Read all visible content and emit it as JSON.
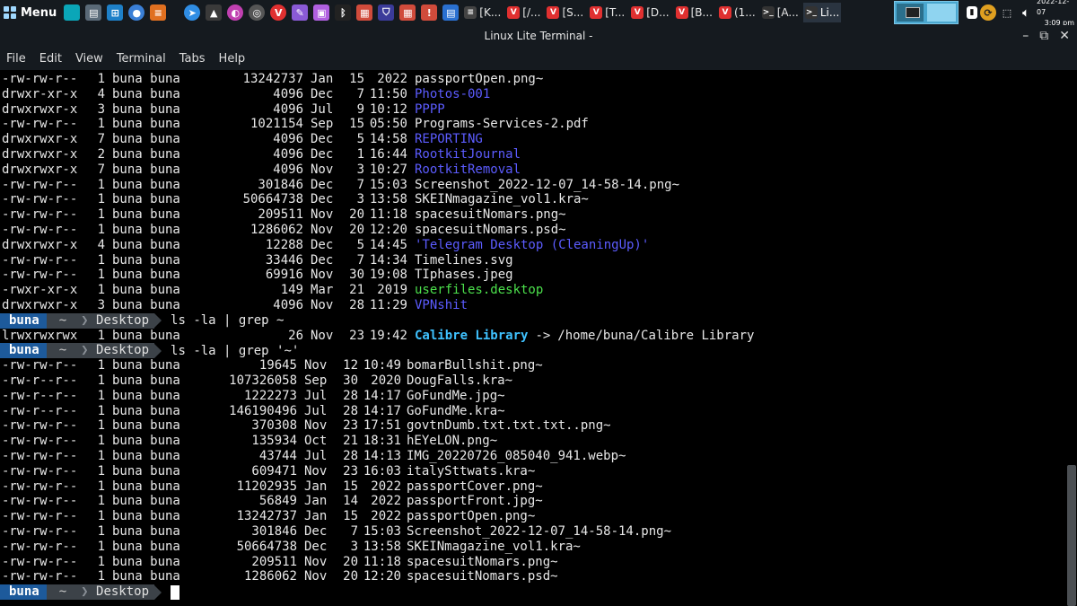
{
  "taskbar": {
    "menu_label": "Menu",
    "tasks": [
      {
        "label": "[K...",
        "icon": "app-icon"
      },
      {
        "label": "[/...",
        "icon": "vivaldi-icon"
      },
      {
        "label": "[S...",
        "icon": "vivaldi-icon"
      },
      {
        "label": "[T...",
        "icon": "vivaldi-icon"
      },
      {
        "label": "[D...",
        "icon": "vivaldi-icon"
      },
      {
        "label": "[B...",
        "icon": "vivaldi-icon"
      },
      {
        "label": "(1...",
        "icon": "vivaldi-icon"
      },
      {
        "label": "[A...",
        "icon": "terminal-icon"
      },
      {
        "label": "Li...",
        "icon": "terminal-icon"
      }
    ],
    "clock": {
      "date": "2022-12-07",
      "time": "3:09 pm"
    }
  },
  "window": {
    "title": "Linux Lite Terminal -"
  },
  "menubar": {
    "items": [
      "File",
      "Edit",
      "View",
      "Terminal",
      "Tabs",
      "Help"
    ]
  },
  "colors": {
    "dir": "#5c5cff",
    "exe": "#4ce04c",
    "link": "#3fc2ff",
    "prompt_user_bg": "#1d5a9b",
    "prompt_path_bg": "#3c4248"
  },
  "listing1": [
    {
      "perm": "-rw-rw-r--",
      "links": "1",
      "owner": "buna buna",
      "size": "13242737",
      "month": "Jan",
      "day": "15",
      "time": "2022",
      "name": "passportOpen.png~",
      "type": "file"
    },
    {
      "perm": "drwxr-xr-x",
      "links": "4",
      "owner": "buna buna",
      "size": "4096",
      "month": "Dec",
      "day": "7",
      "time": "11:50",
      "name": "Photos-001",
      "type": "dir"
    },
    {
      "perm": "drwxrwxr-x",
      "links": "3",
      "owner": "buna buna",
      "size": "4096",
      "month": "Jul",
      "day": "9",
      "time": "10:12",
      "name": "PPPP",
      "type": "dir"
    },
    {
      "perm": "-rw-rw-r--",
      "links": "1",
      "owner": "buna buna",
      "size": "1021154",
      "month": "Sep",
      "day": "15",
      "time": "05:50",
      "name": "Programs-Services-2.pdf",
      "type": "file"
    },
    {
      "perm": "drwxrwxr-x",
      "links": "7",
      "owner": "buna buna",
      "size": "4096",
      "month": "Dec",
      "day": "5",
      "time": "14:58",
      "name": "REPORTING",
      "type": "dir"
    },
    {
      "perm": "drwxrwxr-x",
      "links": "2",
      "owner": "buna buna",
      "size": "4096",
      "month": "Dec",
      "day": "1",
      "time": "16:44",
      "name": "RootkitJournal",
      "type": "dir"
    },
    {
      "perm": "drwxrwxr-x",
      "links": "7",
      "owner": "buna buna",
      "size": "4096",
      "month": "Nov",
      "day": "3",
      "time": "10:27",
      "name": "RootkitRemoval",
      "type": "dir"
    },
    {
      "perm": "-rw-rw-r--",
      "links": "1",
      "owner": "buna buna",
      "size": "301846",
      "month": "Dec",
      "day": "7",
      "time": "15:03",
      "name": "Screenshot_2022-12-07_14-58-14.png~",
      "type": "file"
    },
    {
      "perm": "-rw-rw-r--",
      "links": "1",
      "owner": "buna buna",
      "size": "50664738",
      "month": "Dec",
      "day": "3",
      "time": "13:58",
      "name": "SKEINmagazine_vol1.kra~",
      "type": "file"
    },
    {
      "perm": "-rw-rw-r--",
      "links": "1",
      "owner": "buna buna",
      "size": "209511",
      "month": "Nov",
      "day": "20",
      "time": "11:18",
      "name": "spacesuitNomars.png~",
      "type": "file"
    },
    {
      "perm": "-rw-rw-r--",
      "links": "1",
      "owner": "buna buna",
      "size": "1286062",
      "month": "Nov",
      "day": "20",
      "time": "12:20",
      "name": "spacesuitNomars.psd~",
      "type": "file"
    },
    {
      "perm": "drwxrwxr-x",
      "links": "4",
      "owner": "buna buna",
      "size": "12288",
      "month": "Dec",
      "day": "5",
      "time": "14:45",
      "name": "'Telegram Desktop (CleaningUp)'",
      "type": "dir"
    },
    {
      "perm": "-rw-rw-r--",
      "links": "1",
      "owner": "buna buna",
      "size": "33446",
      "month": "Dec",
      "day": "7",
      "time": "14:34",
      "name": "Timelines.svg",
      "type": "file"
    },
    {
      "perm": "-rw-rw-r--",
      "links": "1",
      "owner": "buna buna",
      "size": "69916",
      "month": "Nov",
      "day": "30",
      "time": "19:08",
      "name": "TIphases.jpeg",
      "type": "file"
    },
    {
      "perm": "-rwxr-xr-x",
      "links": "1",
      "owner": "buna buna",
      "size": "149",
      "month": "Mar",
      "day": "21",
      "time": "2019",
      "name": "userfiles.desktop",
      "type": "exe"
    },
    {
      "perm": "drwxrwxr-x",
      "links": "3",
      "owner": "buna buna",
      "size": "4096",
      "month": "Nov",
      "day": "28",
      "time": "11:29",
      "name": "VPNshit",
      "type": "dir"
    }
  ],
  "prompt1": {
    "user": "buna",
    "home": "~",
    "dir": "Desktop",
    "command": "ls -la | grep ~"
  },
  "link_line": {
    "perm": "lrwxrwxrwx",
    "links": "1",
    "owner": "buna buna",
    "size": "26",
    "month": "Nov",
    "day": "23",
    "time": "19:42",
    "name": "Calibre Library",
    "arrow": "->",
    "target": "/home/buna/Calibre Library"
  },
  "prompt2": {
    "user": "buna",
    "home": "~",
    "dir": "Desktop",
    "command": "ls -la | grep '~'"
  },
  "listing2": [
    {
      "perm": "-rw-rw-r--",
      "links": "1",
      "owner": "buna buna",
      "size": "19645",
      "month": "Nov",
      "day": "12",
      "time": "10:49",
      "name": "bomarBullshit.png~"
    },
    {
      "perm": "-rw-r--r--",
      "links": "1",
      "owner": "buna buna",
      "size": "107326058",
      "month": "Sep",
      "day": "30",
      "time": "2020",
      "name": "DougFalls.kra~"
    },
    {
      "perm": "-rw-r--r--",
      "links": "1",
      "owner": "buna buna",
      "size": "1222273",
      "month": "Jul",
      "day": "28",
      "time": "14:17",
      "name": "GoFundMe.jpg~"
    },
    {
      "perm": "-rw-r--r--",
      "links": "1",
      "owner": "buna buna",
      "size": "146190496",
      "month": "Jul",
      "day": "28",
      "time": "14:17",
      "name": "GoFundMe.kra~"
    },
    {
      "perm": "-rw-rw-r--",
      "links": "1",
      "owner": "buna buna",
      "size": "370308",
      "month": "Nov",
      "day": "23",
      "time": "17:51",
      "name": "govtnDumb.txt.txt.txt..png~"
    },
    {
      "perm": "-rw-rw-r--",
      "links": "1",
      "owner": "buna buna",
      "size": "135934",
      "month": "Oct",
      "day": "21",
      "time": "18:31",
      "name": "hEYeLON.png~"
    },
    {
      "perm": "-rw-rw-r--",
      "links": "1",
      "owner": "buna buna",
      "size": "43744",
      "month": "Jul",
      "day": "28",
      "time": "14:13",
      "name": "IMG_20220726_085040_941.webp~"
    },
    {
      "perm": "-rw-rw-r--",
      "links": "1",
      "owner": "buna buna",
      "size": "609471",
      "month": "Nov",
      "day": "23",
      "time": "16:03",
      "name": "italySttwats.kra~"
    },
    {
      "perm": "-rw-rw-r--",
      "links": "1",
      "owner": "buna buna",
      "size": "11202935",
      "month": "Jan",
      "day": "15",
      "time": "2022",
      "name": "passportCover.png~"
    },
    {
      "perm": "-rw-rw-r--",
      "links": "1",
      "owner": "buna buna",
      "size": "56849",
      "month": "Jan",
      "day": "14",
      "time": "2022",
      "name": "passportFront.jpg~"
    },
    {
      "perm": "-rw-rw-r--",
      "links": "1",
      "owner": "buna buna",
      "size": "13242737",
      "month": "Jan",
      "day": "15",
      "time": "2022",
      "name": "passportOpen.png~"
    },
    {
      "perm": "-rw-rw-r--",
      "links": "1",
      "owner": "buna buna",
      "size": "301846",
      "month": "Dec",
      "day": "7",
      "time": "15:03",
      "name": "Screenshot_2022-12-07_14-58-14.png~"
    },
    {
      "perm": "-rw-rw-r--",
      "links": "1",
      "owner": "buna buna",
      "size": "50664738",
      "month": "Dec",
      "day": "3",
      "time": "13:58",
      "name": "SKEINmagazine_vol1.kra~"
    },
    {
      "perm": "-rw-rw-r--",
      "links": "1",
      "owner": "buna buna",
      "size": "209511",
      "month": "Nov",
      "day": "20",
      "time": "11:18",
      "name": "spacesuitNomars.png~"
    },
    {
      "perm": "-rw-rw-r--",
      "links": "1",
      "owner": "buna buna",
      "size": "1286062",
      "month": "Nov",
      "day": "20",
      "time": "12:20",
      "name": "spacesuitNomars.psd~"
    }
  ],
  "prompt3": {
    "user": "buna",
    "home": "~",
    "dir": "Desktop",
    "command": ""
  }
}
